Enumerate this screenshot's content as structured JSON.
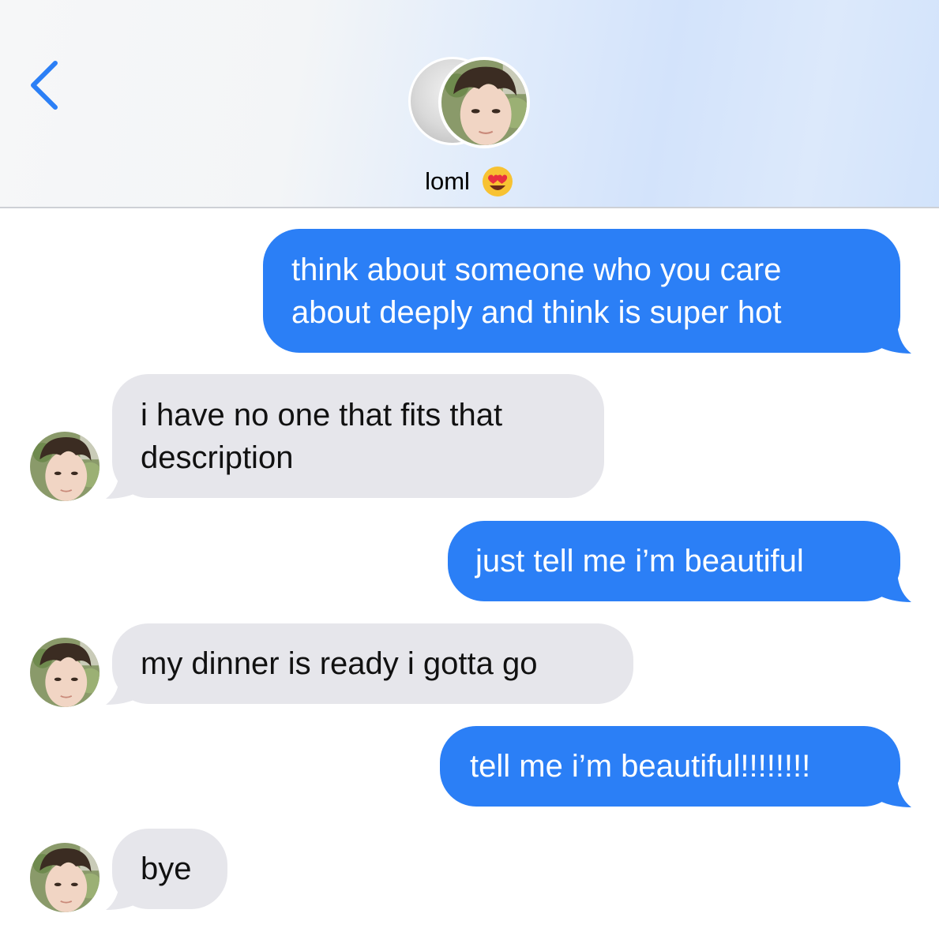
{
  "header": {
    "back_icon": "chevron-left-icon",
    "contact_name": "loml",
    "contact_emoji": "heart-eyes-emoji",
    "accent_color": "#2b7ff6"
  },
  "messages": [
    {
      "direction": "outgoing",
      "lines": [
        "think about someone who you care",
        "about deeply and think is super hot"
      ]
    },
    {
      "direction": "incoming",
      "lines": [
        "i have no one that fits that",
        "description"
      ]
    },
    {
      "direction": "outgoing",
      "lines": [
        "just tell me i’m beautiful"
      ]
    },
    {
      "direction": "incoming",
      "lines": [
        "my dinner is ready i gotta go"
      ]
    },
    {
      "direction": "outgoing",
      "lines": [
        "tell me i’m beautiful!!!!!!!!"
      ]
    },
    {
      "direction": "incoming",
      "lines": [
        "bye"
      ]
    }
  ],
  "colors": {
    "outgoing_bubble": "#2b7ff6",
    "incoming_bubble": "#e6e6eb"
  }
}
